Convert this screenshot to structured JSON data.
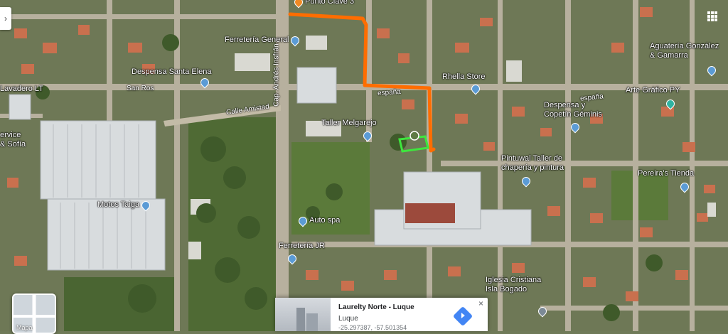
{
  "map": {
    "pois": [
      {
        "id": "punto-clave",
        "label": "Punto Clave 3",
        "pin": "orange"
      },
      {
        "id": "ferreteria-general",
        "label": "Ferretería General",
        "pin": "blue"
      },
      {
        "id": "despensa-santa-elena",
        "label": "Despensa Santa Elena",
        "pin": "blue"
      },
      {
        "id": "lavadero",
        "label": "Lavadero LT",
        "pin": "none"
      },
      {
        "id": "service-sofia",
        "label": "ervice\n& Sofía",
        "pin": "none"
      },
      {
        "id": "taller-melgarejo",
        "label": "Taller Melgarejo",
        "pin": "blue"
      },
      {
        "id": "rhella-store",
        "label": "Rhella Store",
        "pin": "blue"
      },
      {
        "id": "agueteria",
        "label": "Aguatería González\n& Gamarra",
        "pin": "blue"
      },
      {
        "id": "arte-grafico",
        "label": "Arte Gráfico PY",
        "pin": "teal"
      },
      {
        "id": "despensa-copetin",
        "label": "Despensa y\nCopetín Géminis",
        "pin": "blue"
      },
      {
        "id": "pintuwal",
        "label": "Pintuwal Taller de\nchapería y pintura",
        "pin": "blue"
      },
      {
        "id": "pereiras",
        "label": "Pereira's Tienda",
        "pin": "blue"
      },
      {
        "id": "motos-taiga",
        "label": "Motos Taiga",
        "pin": "blue"
      },
      {
        "id": "auto-spa",
        "label": "Auto spa",
        "pin": "blue"
      },
      {
        "id": "ferreteria-jr",
        "label": "Ferretería JR",
        "pin": "blue"
      },
      {
        "id": "iglesia",
        "label": "Iglesia Cristiana\nIsla Bogado",
        "pin": "grey"
      }
    ],
    "streets": [
      {
        "id": "san-ros",
        "label": "San Ros"
      },
      {
        "id": "calle-amistad",
        "label": "Calle Amistad"
      },
      {
        "id": "cap-andres",
        "label": "Cap. Andrés Insfrán"
      },
      {
        "id": "espana-1",
        "label": "españa"
      },
      {
        "id": "espana-2",
        "label": "españa"
      }
    ]
  },
  "layer_toggle": {
    "label": "Mapa"
  },
  "place_card": {
    "title": "Laurelty Norte - Luque",
    "subtitle": "Luque",
    "coords": "-25.297387, -57.501354",
    "close": "×"
  },
  "left_tab": {
    "glyph": "›"
  },
  "colors": {
    "route": "#ff6d00",
    "highlight": "#3ee63e",
    "road": "#b9b4a6",
    "highway": "#8d8a82"
  }
}
